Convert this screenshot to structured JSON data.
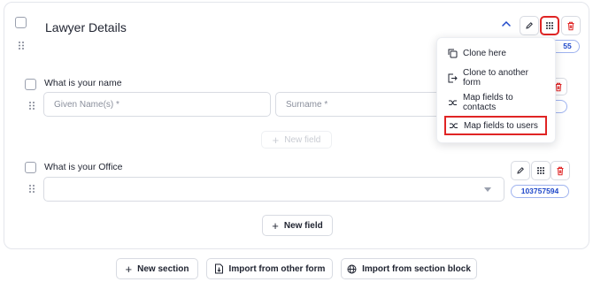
{
  "section": {
    "title": "Lawyer Details",
    "id_badge": "55"
  },
  "questions": [
    {
      "title": "What is your name",
      "inputs": [
        {
          "placeholder": "Given Name(s) *"
        },
        {
          "placeholder": "Surname *"
        }
      ],
      "new_field_label": "New field"
    },
    {
      "title": "What is your Office",
      "select_value": "",
      "id_badge": "103757594"
    }
  ],
  "new_field_label": "New field",
  "menu": {
    "items": [
      {
        "label": "Clone here",
        "icon": "clone-icon"
      },
      {
        "label": "Clone to another form",
        "icon": "move-to-form-icon"
      },
      {
        "label": "Map fields to contacts",
        "icon": "map-fields-icon"
      },
      {
        "label": "Map fields to users",
        "icon": "map-fields-icon",
        "highlighted": true
      }
    ]
  },
  "bottom_actions": {
    "new_section": "New section",
    "import_other_form": "Import from other form",
    "import_section_block": "Import from section block"
  },
  "colors": {
    "accent_blue": "#1e47c9",
    "danger_red": "#e02424",
    "border": "#d8dbe2"
  }
}
